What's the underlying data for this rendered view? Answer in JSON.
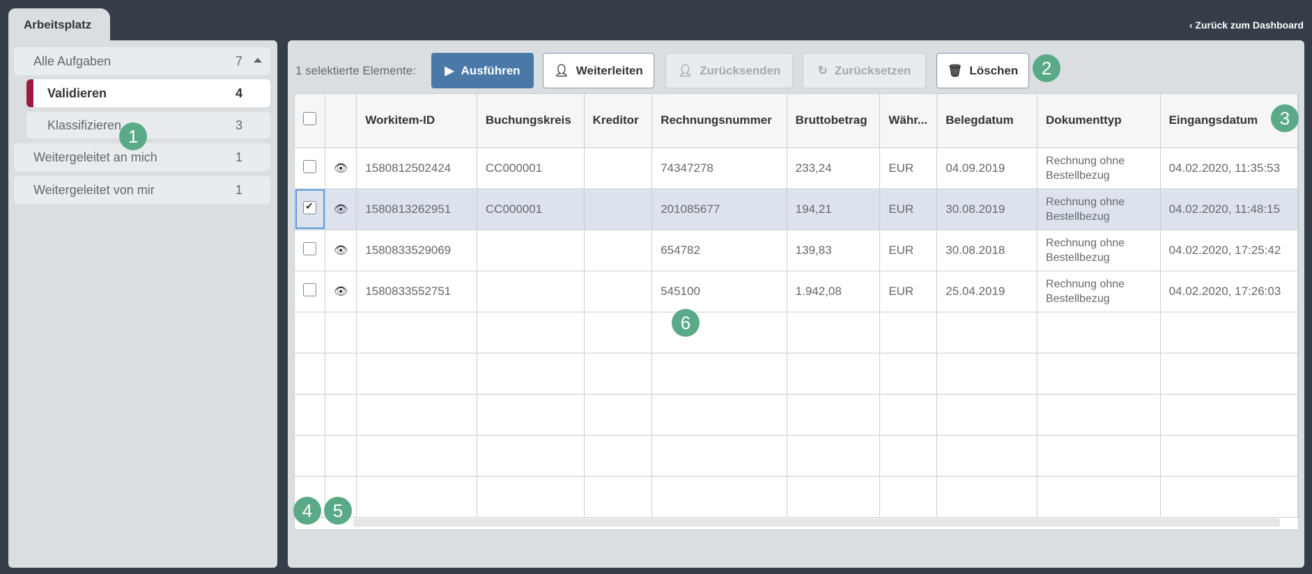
{
  "tab": "Arbeitsplatz",
  "back_link": "Zurück zum Dashboard",
  "sidebar": {
    "items": [
      {
        "label": "Alle Aufgaben",
        "count": "7"
      },
      {
        "label": "Validieren",
        "count": "4"
      },
      {
        "label": "Klassifizieren",
        "count": "3"
      },
      {
        "label": "Weitergeleitet an mich",
        "count": "1"
      },
      {
        "label": "Weitergeleitet von mir",
        "count": "1"
      }
    ]
  },
  "toolbar": {
    "selected_label": "1 selektierte Elemente:",
    "execute": "Ausführen",
    "forward": "Weiterleiten",
    "send_back": "Zurücksenden",
    "reset": "Zurücksetzen",
    "delete": "Löschen"
  },
  "badges": [
    "1",
    "2",
    "3",
    "4",
    "5",
    "6"
  ],
  "table": {
    "headers": [
      "Workitem-ID",
      "Buchungskreis",
      "Kreditor",
      "Rechnungsnummer",
      "Bruttobetrag",
      "Währ...",
      "Belegdatum",
      "Dokumenttyp",
      "Eingangsdatum"
    ],
    "rows": [
      [
        "1580812502424",
        "CC000001",
        "",
        "74347278",
        "233,24",
        "EUR",
        "04.09.2019",
        "Rechnung ohne Bestellbezug",
        "04.02.2020, 11:35:53"
      ],
      [
        "1580813262951",
        "CC000001",
        "",
        "201085677",
        "194,21",
        "EUR",
        "30.08.2019",
        "Rechnung ohne Bestellbezug",
        "04.02.2020, 11:48:15"
      ],
      [
        "1580833529069",
        "",
        "",
        "654782",
        "139,83",
        "EUR",
        "30.08.2018",
        "Rechnung ohne Bestellbezug",
        "04.02.2020, 17:25:42"
      ],
      [
        "1580833552751",
        "",
        "",
        "545100",
        "1.942,08",
        "EUR",
        "25.04.2019",
        "Rechnung ohne Bestellbezug",
        "04.02.2020, 17:26:03"
      ]
    ],
    "selected_row": 1
  }
}
